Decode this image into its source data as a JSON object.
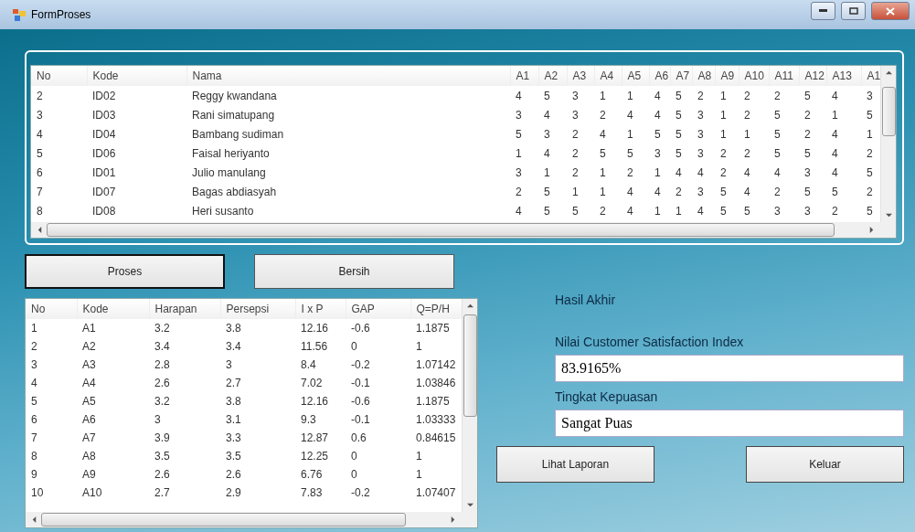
{
  "window": {
    "title": "FormProses"
  },
  "respondent_table": {
    "columns": [
      "No",
      "Kode",
      "Nama",
      "A1",
      "A2",
      "A3",
      "A4",
      "A5",
      "A6",
      "A7",
      "A8",
      "A9",
      "A10",
      "A11",
      "A12",
      "A13",
      "A1"
    ],
    "rows": [
      [
        "2",
        "ID02",
        "Reggy kwandana",
        "4",
        "5",
        "3",
        "1",
        "1",
        "4",
        "5",
        "2",
        "1",
        "2",
        "2",
        "5",
        "4",
        "3"
      ],
      [
        "3",
        "ID03",
        "Rani simatupang",
        "3",
        "4",
        "3",
        "2",
        "4",
        "4",
        "5",
        "3",
        "1",
        "2",
        "5",
        "2",
        "1",
        "5"
      ],
      [
        "4",
        "ID04",
        "Bambang sudiman",
        "5",
        "3",
        "2",
        "4",
        "1",
        "5",
        "5",
        "3",
        "1",
        "1",
        "5",
        "2",
        "4",
        "1"
      ],
      [
        "5",
        "ID06",
        "Faisal heriyanto",
        "1",
        "4",
        "2",
        "5",
        "5",
        "3",
        "5",
        "3",
        "2",
        "2",
        "5",
        "5",
        "4",
        "2"
      ],
      [
        "6",
        "ID01",
        "Julio manulang",
        "3",
        "1",
        "2",
        "1",
        "2",
        "1",
        "4",
        "4",
        "2",
        "4",
        "4",
        "3",
        "4",
        "5"
      ],
      [
        "7",
        "ID07",
        "Bagas abdiasyah",
        "2",
        "5",
        "1",
        "1",
        "4",
        "4",
        "2",
        "3",
        "5",
        "4",
        "2",
        "5",
        "5",
        "2"
      ],
      [
        "8",
        "ID08",
        "Heri susanto",
        "4",
        "5",
        "5",
        "2",
        "4",
        "1",
        "1",
        "4",
        "5",
        "5",
        "3",
        "3",
        "2",
        "5"
      ]
    ]
  },
  "buttons_top": [
    {
      "label": "Proses",
      "focused": true
    },
    {
      "label": "Bersih",
      "focused": false
    }
  ],
  "result_table": {
    "columns": [
      "No",
      "Kode",
      "Harapan",
      "Persepsi",
      "I x P",
      "GAP",
      "Q=P/H"
    ],
    "rows": [
      [
        "1",
        "A1",
        "3.2",
        "3.8",
        "12.16",
        "-0.6",
        "1.1875"
      ],
      [
        "2",
        "A2",
        "3.4",
        "3.4",
        "11.56",
        "0",
        "1"
      ],
      [
        "3",
        "A3",
        "2.8",
        "3",
        "8.4",
        "-0.2",
        "1.07142"
      ],
      [
        "4",
        "A4",
        "2.6",
        "2.7",
        "7.02",
        "-0.1",
        "1.03846"
      ],
      [
        "5",
        "A5",
        "3.2",
        "3.8",
        "12.16",
        "-0.6",
        "1.1875"
      ],
      [
        "6",
        "A6",
        "3",
        "3.1",
        "9.3",
        "-0.1",
        "1.03333"
      ],
      [
        "7",
        "A7",
        "3.9",
        "3.3",
        "12.87",
        "0.6",
        "0.84615"
      ],
      [
        "8",
        "A8",
        "3.5",
        "3.5",
        "12.25",
        "0",
        "1"
      ],
      [
        "9",
        "A9",
        "2.6",
        "2.6",
        "6.76",
        "0",
        "1"
      ],
      [
        "10",
        "A10",
        "2.7",
        "2.9",
        "7.83",
        "-0.2",
        "1.07407"
      ]
    ]
  },
  "result": {
    "heading": "Hasil Akhir",
    "csi_label": "Nilai Customer Satisfaction Index",
    "csi_value": "83.9165%",
    "level_label": "Tingkat Kepuasan",
    "level_value": "Sangat Puas"
  },
  "buttons_bottom": [
    "Lihat Laporan",
    "Keluar"
  ]
}
